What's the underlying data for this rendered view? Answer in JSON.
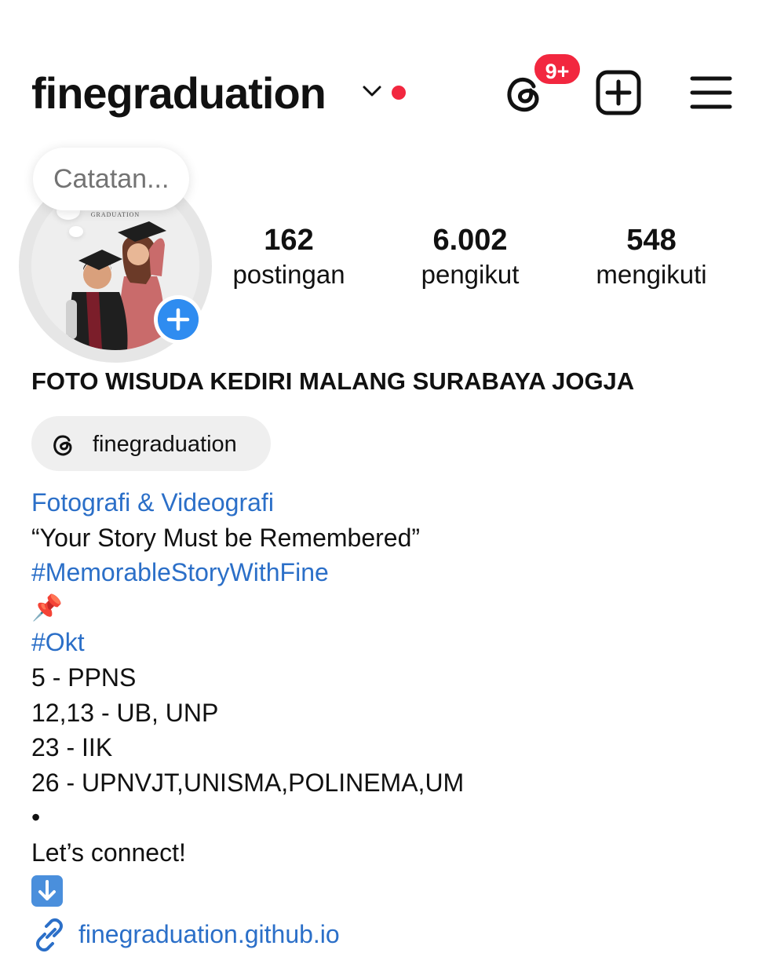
{
  "header": {
    "username": "finegraduation",
    "notification_badge": "9+"
  },
  "profile": {
    "note_placeholder": "Catatan...",
    "avatar_caption": "GRADUATION",
    "stats": [
      {
        "value": "162",
        "label": "postingan"
      },
      {
        "value": "6.002",
        "label": "pengikut"
      },
      {
        "value": "548",
        "label": "mengikuti"
      }
    ],
    "display_name": "FOTO WISUDA KEDIRI MALANG SURABAYA JOGJA",
    "threads_handle": "finegraduation"
  },
  "bio": {
    "category": "Fotografi & Videografi",
    "tagline": "“Your Story Must be Remembered”",
    "hashtag": "#MemorableStoryWithFine",
    "pin_emoji": "📌",
    "month_tag": "#Okt",
    "schedule": [
      "5 - PPNS",
      "12,13 - UB, UNP",
      "23 - IIK",
      "26 - UPNVJT,UNISMA,POLINEMA,UM"
    ],
    "separator": "•",
    "cta": "Let’s connect!",
    "link": "finegraduation.github.io"
  },
  "colors": {
    "link_blue": "#2b6fc8",
    "badge_red": "#f2273f",
    "avatar_plus_blue": "#2f8cf0"
  }
}
